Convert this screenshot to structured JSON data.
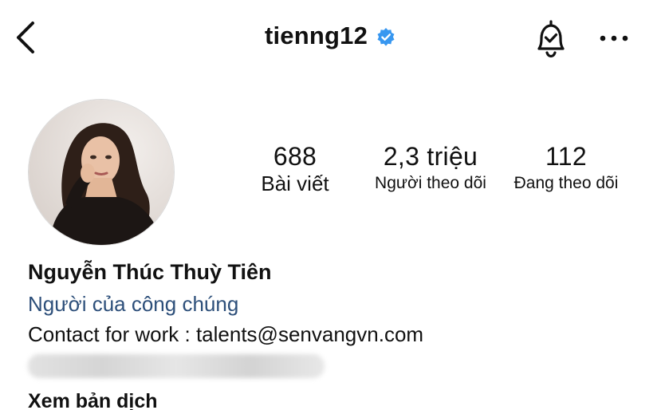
{
  "header": {
    "username": "tienng12",
    "verified": true,
    "icons": {
      "back": "chevron-left-icon",
      "verified": "verified-badge-icon",
      "notifications": "bell-check-icon",
      "more": "more-horizontal-icon"
    },
    "accent_color": "#3897f0"
  },
  "profile": {
    "avatar": "profile-photo",
    "stats": [
      {
        "value": "688",
        "label": "Bài viết"
      },
      {
        "value": "2,3 triệu",
        "label": "Người theo dõi"
      },
      {
        "value": "112",
        "label": "Đang theo dõi"
      }
    ]
  },
  "bio": {
    "full_name": "Nguyễn Thúc Thuỳ Tiên",
    "category": "Người của công chúng",
    "category_color": "#2d4f7a",
    "contact": "Contact for work : talents@senvangvn.com",
    "translate_label": "Xem bản dịch"
  }
}
